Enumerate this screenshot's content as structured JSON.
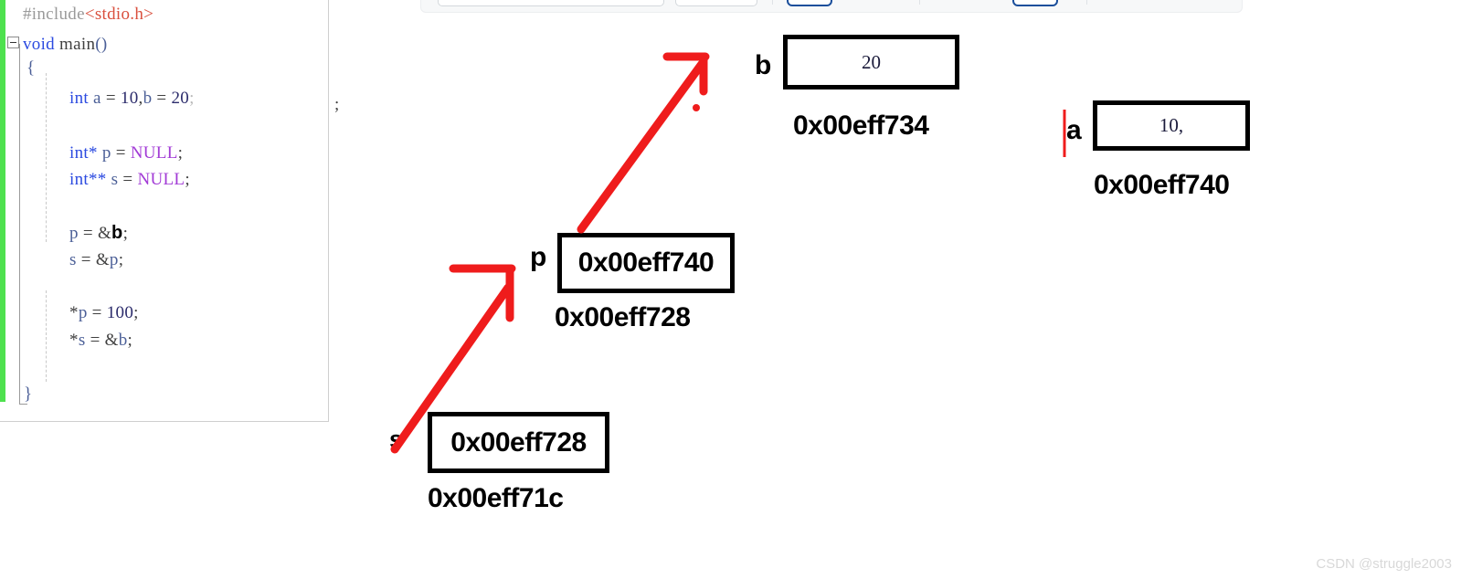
{
  "toolbar": {
    "fields": [
      {
        "name": "toolbar-search-field"
      },
      {
        "name": "toolbar-filter-field"
      }
    ],
    "buttons": [
      {
        "name": "toolbar-primary-button-1"
      },
      {
        "name": "toolbar-primary-button-2"
      }
    ]
  },
  "editor": {
    "lines": [
      {
        "id": "line-include",
        "tokens": [
          {
            "text": "#include",
            "cls": "k-pre"
          },
          {
            "text": "<stdio.h>",
            "cls": "k-inc"
          }
        ]
      },
      {
        "id": "line-main",
        "tokens": [
          {
            "text": "void",
            "cls": "k-type"
          },
          {
            "text": " ",
            "cls": "k-plain"
          },
          {
            "text": "main",
            "cls": "k-plain"
          },
          {
            "text": "()",
            "cls": "k-brace"
          }
        ]
      },
      {
        "id": "line-open-brace",
        "tokens": [
          {
            "text": "{",
            "cls": "k-brace"
          }
        ]
      },
      {
        "id": "line-decl-ab",
        "tokens": [
          {
            "text": "int",
            "cls": "k-type"
          },
          {
            "text": " ",
            "cls": "k-plain"
          },
          {
            "text": "a",
            "cls": "k-id"
          },
          {
            "text": " = ",
            "cls": "k-plain"
          },
          {
            "text": "10",
            "cls": "k-num"
          },
          {
            "text": ",",
            "cls": "k-plain"
          },
          {
            "text": "b",
            "cls": "k-id"
          },
          {
            "text": " = ",
            "cls": "k-plain"
          },
          {
            "text": "20",
            "cls": "k-num"
          },
          {
            "text": ";",
            "cls": "k-semi"
          }
        ]
      },
      {
        "id": "line-decl-p",
        "tokens": [
          {
            "text": "int*",
            "cls": "k-type"
          },
          {
            "text": " ",
            "cls": "k-plain"
          },
          {
            "text": "p",
            "cls": "k-id"
          },
          {
            "text": " = ",
            "cls": "k-plain"
          },
          {
            "text": "NULL",
            "cls": "k-null"
          },
          {
            "text": ";",
            "cls": "k-plain"
          }
        ]
      },
      {
        "id": "line-decl-s",
        "tokens": [
          {
            "text": "int**",
            "cls": "k-type"
          },
          {
            "text": " ",
            "cls": "k-plain"
          },
          {
            "text": "s",
            "cls": "k-id"
          },
          {
            "text": " = ",
            "cls": "k-plain"
          },
          {
            "text": "NULL",
            "cls": "k-null"
          },
          {
            "text": ";",
            "cls": "k-plain"
          }
        ]
      },
      {
        "id": "line-assign-p",
        "tokens": [
          {
            "text": "p",
            "cls": "k-id"
          },
          {
            "text": " = ",
            "cls": "k-plain"
          },
          {
            "text": "&",
            "cls": "k-plain"
          },
          {
            "text": "b",
            "cls": "k-mark"
          },
          {
            "text": ";",
            "cls": "k-plain"
          }
        ]
      },
      {
        "id": "line-assign-s",
        "tokens": [
          {
            "text": "s",
            "cls": "k-id"
          },
          {
            "text": " = ",
            "cls": "k-plain"
          },
          {
            "text": "&",
            "cls": "k-plain"
          },
          {
            "text": "p",
            "cls": "k-id"
          },
          {
            "text": ";",
            "cls": "k-plain"
          }
        ]
      },
      {
        "id": "line-deref-p",
        "tokens": [
          {
            "text": "*",
            "cls": "k-plain"
          },
          {
            "text": "p",
            "cls": "k-id"
          },
          {
            "text": " = ",
            "cls": "k-plain"
          },
          {
            "text": "100",
            "cls": "k-num"
          },
          {
            "text": ";",
            "cls": "k-plain"
          }
        ]
      },
      {
        "id": "line-deref-s",
        "tokens": [
          {
            "text": "*",
            "cls": "k-plain"
          },
          {
            "text": "s",
            "cls": "k-id"
          },
          {
            "text": " = ",
            "cls": "k-plain"
          },
          {
            "text": "&",
            "cls": "k-plain"
          },
          {
            "text": "b",
            "cls": "k-id"
          },
          {
            "text": ";",
            "cls": "k-plain"
          }
        ]
      },
      {
        "id": "line-close-brace",
        "tokens": [
          {
            "text": "}",
            "cls": "k-brace"
          }
        ]
      }
    ],
    "stray_semicolon": ";"
  },
  "diagram": {
    "cells": [
      {
        "id": "cell-b",
        "var": "b",
        "value": "20",
        "address": "0x00eff734",
        "value_style": "serif"
      },
      {
        "id": "cell-a",
        "var": "a",
        "value": "10,",
        "address": "0x00eff740",
        "value_style": "serif"
      },
      {
        "id": "cell-p",
        "var": "p",
        "value": "0x00eff740",
        "address": "0x00eff728",
        "value_style": "bold"
      },
      {
        "id": "cell-s",
        "var": "s",
        "value": "0x00eff728",
        "address": "0x00eff71c",
        "value_style": "bold"
      }
    ],
    "annotation_color": "#ef1c1c",
    "arrows": [
      {
        "id": "arrow-s-to-p",
        "from": "cell-s",
        "to": "cell-p"
      },
      {
        "id": "arrow-p-to-b",
        "from": "cell-p",
        "to": "cell-b"
      }
    ]
  },
  "watermark": "CSDN @struggle2003"
}
